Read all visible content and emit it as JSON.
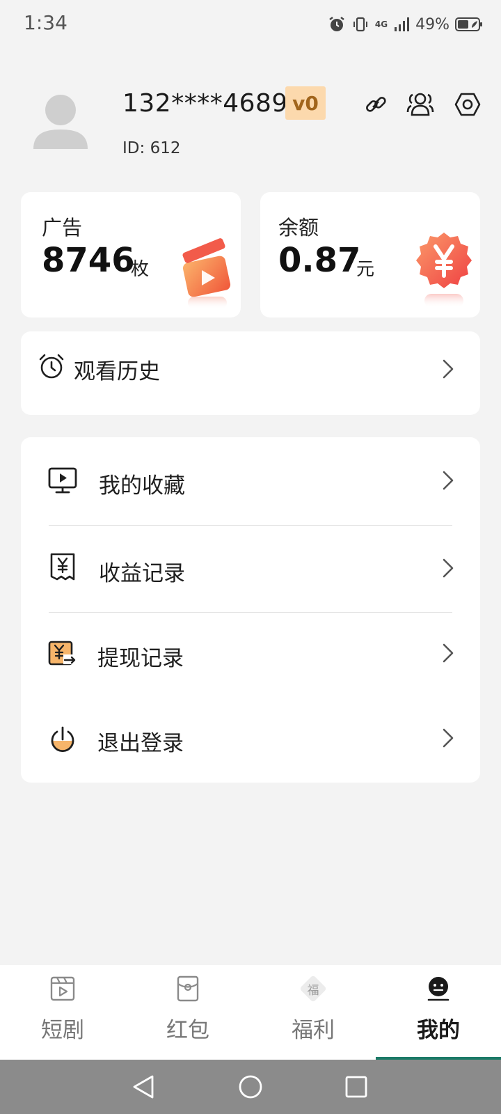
{
  "status_bar": {
    "time": "1:34",
    "network": "4G",
    "battery": "49%"
  },
  "profile": {
    "phone": "132****4689",
    "level": "v0",
    "id_label": "ID:",
    "id_value": "612",
    "actions": [
      "link-icon",
      "users-icon",
      "settings-icon"
    ]
  },
  "stats": {
    "ads": {
      "label": "广告",
      "value": "8746",
      "unit": "枚"
    },
    "balance": {
      "label": "余额",
      "value": "0.87",
      "unit": "元"
    }
  },
  "history": {
    "label": "观看历史",
    "icon": "alarm-clock-icon"
  },
  "menu": [
    {
      "label": "我的收藏",
      "icon": "tv-icon"
    },
    {
      "label": "收益记录",
      "icon": "yuan-receipt-icon"
    },
    {
      "label": "提现记录",
      "icon": "withdraw-icon"
    },
    {
      "label": "退出登录",
      "icon": "power-icon"
    }
  ],
  "bottom_nav": {
    "items": [
      {
        "label": "短剧",
        "icon": "video-icon"
      },
      {
        "label": "红包",
        "icon": "red-packet-icon"
      },
      {
        "label": "福利",
        "icon": "fu-diamond-icon",
        "glyph": "福"
      },
      {
        "label": "我的",
        "icon": "face-icon"
      }
    ],
    "active_index": 3,
    "accent_color": "#1b7a67"
  },
  "colors": {
    "background": "#f3f3f3",
    "card": "#ffffff",
    "level_badge_bg": "#fcd9ad",
    "level_badge_text": "#a1651c",
    "illustration_orange": "#f4743c",
    "illustration_red": "#f04a4a"
  }
}
